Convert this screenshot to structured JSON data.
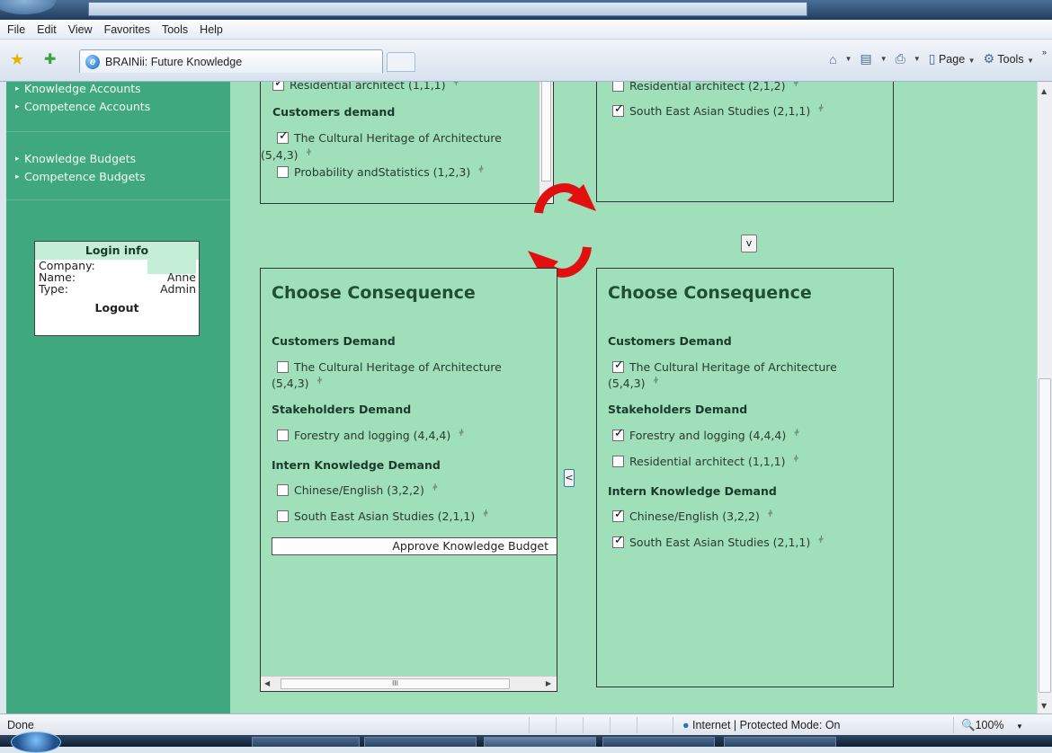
{
  "browser": {
    "menu": [
      "File",
      "Edit",
      "View",
      "Favorites",
      "Tools",
      "Help"
    ],
    "tab_title": "BRAINii: Future Knowledge",
    "commands": {
      "page": "Page",
      "tools": "Tools"
    }
  },
  "sidebar": {
    "group1": [
      "Knowledge Accounts",
      "Competence Accounts"
    ],
    "group2": [
      "Knowledge Budgets",
      "Competence Budgets"
    ]
  },
  "login": {
    "title": "Login info",
    "company_label": "Company:",
    "company_value": "",
    "name_label": "Name:",
    "name_value": "Anne",
    "type_label": "Type:",
    "type_value": "Admin",
    "logout": "Logout"
  },
  "top_left_panel": {
    "cut_item": "Residential architect (1,1,1)",
    "section": "Customers demand",
    "items": [
      {
        "label": "The Cultural Heritage of Architecture",
        "label_cont": "(5,4,3)",
        "checked": true
      },
      {
        "label": "Probability andStatistics (1,2,3)",
        "checked": false
      }
    ]
  },
  "top_right_panel": {
    "cut_item": "Residential architect (2,1,2)",
    "items": [
      {
        "label": "South East Asian Studies (2,1,1)",
        "checked": true
      }
    ]
  },
  "down_button": "v",
  "left_button": "<",
  "left_consequence": {
    "heading": "Choose Consequence",
    "sections": {
      "customers": "Customers Demand",
      "stakeholders": "Stakeholders Demand",
      "intern": "Intern Knowledge Demand"
    },
    "items": {
      "cultural": {
        "label": "The Cultural Heritage of Architecture",
        "label_cont": "(5,4,3)",
        "checked": false
      },
      "forestry": {
        "label": "Forestry and logging (4,4,4)",
        "checked": false
      },
      "chinese": {
        "label": "Chinese/English (3,2,2)",
        "checked": false
      },
      "sea": {
        "label": "South East Asian Studies (2,1,1)",
        "checked": false
      }
    },
    "approve_button": "Approve Knowledge Budget",
    "hscroll_thumb": "III"
  },
  "right_consequence": {
    "heading": "Choose Consequence",
    "sections": {
      "customers": "Customers Demand",
      "stakeholders": "Stakeholders Demand",
      "intern": "Intern Knowledge Demand"
    },
    "items": {
      "cultural": {
        "label": "The Cultural Heritage of Architecture",
        "label_cont": "(5,4,3)",
        "checked": true
      },
      "forestry": {
        "label": "Forestry and logging (4,4,4)",
        "checked": true
      },
      "residential": {
        "label": "Residential architect (1,1,1)",
        "checked": false
      },
      "chinese": {
        "label": "Chinese/English (3,2,2)",
        "checked": true
      },
      "sea": {
        "label": "South East Asian Studies (2,1,1)",
        "checked": true
      }
    }
  },
  "status": {
    "text": "Done",
    "zone": "Internet | Protected Mode: On",
    "zoom": "100%"
  },
  "colors": {
    "sidebar": "#40a87f",
    "content": "#9fdfb9",
    "arrows": "#e01010"
  },
  "icons": [
    "favorites-star-icon",
    "add-favorites-icon",
    "ie-icon",
    "home-icon",
    "feeds-icon",
    "print-icon",
    "page-icon",
    "tools-gear-icon",
    "refresh-arrows-icon",
    "globe-icon",
    "zoom-icon"
  ]
}
